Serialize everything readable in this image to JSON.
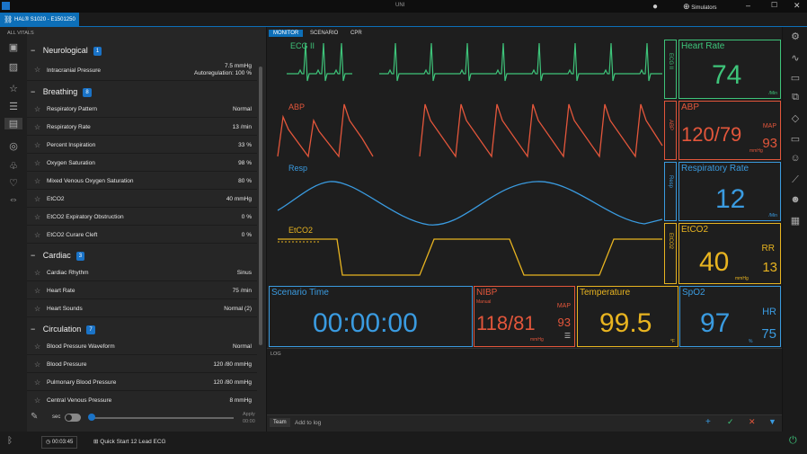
{
  "app": {
    "title": "UNI",
    "tab_label": "HAL® S1020 - E1501250",
    "simulators_label": "Simulators"
  },
  "vitals_panel": {
    "header": "ALL VITALS",
    "sections": [
      {
        "title": "Neurological",
        "count": "1",
        "rows": [
          {
            "name": "Intracranial Pressure",
            "value": "7.5 mmHg",
            "value2": "Autoregulation: 100 %"
          }
        ]
      },
      {
        "title": "Breathing",
        "count": "8",
        "rows": [
          {
            "name": "Respiratory Pattern",
            "value": "Normal"
          },
          {
            "name": "Respiratory Rate",
            "value": "13 /min"
          },
          {
            "name": "Percent Inspiration",
            "value": "33 %"
          },
          {
            "name": "Oxygen Saturation",
            "value": "98 %"
          },
          {
            "name": "Mixed Venous Oxygen Saturation",
            "value": "80 %"
          },
          {
            "name": "EtCO2",
            "value": "40 mmHg"
          },
          {
            "name": "EtCO2 Expiratory Obstruction",
            "value": "0 %"
          },
          {
            "name": "EtCO2 Curare Cleft",
            "value": "0 %"
          }
        ]
      },
      {
        "title": "Cardiac",
        "count": "3",
        "rows": [
          {
            "name": "Cardiac Rhythm",
            "value": "Sinus"
          },
          {
            "name": "Heart Rate",
            "value": "75 /min"
          },
          {
            "name": "Heart Sounds",
            "value": "Normal (2)"
          }
        ]
      },
      {
        "title": "Circulation",
        "count": "7",
        "rows": [
          {
            "name": "Blood Pressure Waveform",
            "value": "Normal"
          },
          {
            "name": "Blood Pressure",
            "value": "120 /80 mmHg"
          },
          {
            "name": "Pulmonary Blood Pressure",
            "value": "120 /80 mmHg"
          },
          {
            "name": "Central Venous Pressure",
            "value": "8 mmHg"
          }
        ]
      }
    ],
    "footer": {
      "sec_label": "sec",
      "apply_label": "Apply",
      "apply_time": "00:00"
    }
  },
  "monitor": {
    "tabs": [
      "MONITOR",
      "SCENARIO",
      "CPR"
    ],
    "waves": {
      "ecg": "ECG II",
      "abp": "ABP",
      "resp": "Resp",
      "etco2": "EtCO2"
    },
    "side_labels": {
      "ecg": "ECG II",
      "abp": "ABP",
      "resp": "Resp",
      "etco2": "EtCO2"
    },
    "heart_rate": {
      "label": "Heart Rate",
      "value": "74",
      "unit": "/Min"
    },
    "abp": {
      "label": "ABP",
      "value": "120/79",
      "map_label": "MAP",
      "map_value": "93",
      "unit": "mmHg"
    },
    "resp_rate": {
      "label": "Respiratory Rate",
      "value": "12",
      "unit": "/Min"
    },
    "etco2": {
      "label": "EtCO2",
      "value": "40",
      "rr_label": "RR",
      "rr_value": "13",
      "unit": "mmHg"
    },
    "scenario_time": {
      "label": "Scenario Time",
      "value": "00:00:00"
    },
    "nibp": {
      "label": "NIBP",
      "sub": "Manual",
      "value": "118/81",
      "map_label": "MAP",
      "map_value": "93",
      "unit": "mmHg"
    },
    "temperature": {
      "label": "Temperature",
      "value": "99.5",
      "unit": "°F"
    },
    "spo2": {
      "label": "SpO2",
      "value": "97",
      "unit": "%",
      "hr_label": "HR",
      "hr_value": "75"
    }
  },
  "log": {
    "title": "LOG",
    "team_label": "Team",
    "add_placeholder": "Add to log"
  },
  "bottom": {
    "timer": "00:03:45",
    "quick_start": "Quick Start 12 Lead ECG"
  },
  "colors": {
    "ecg": "#3ec47a",
    "abp": "#e3563b",
    "resp": "#3a9be0",
    "etco2": "#e8b420",
    "accent": "#1a73c7"
  }
}
